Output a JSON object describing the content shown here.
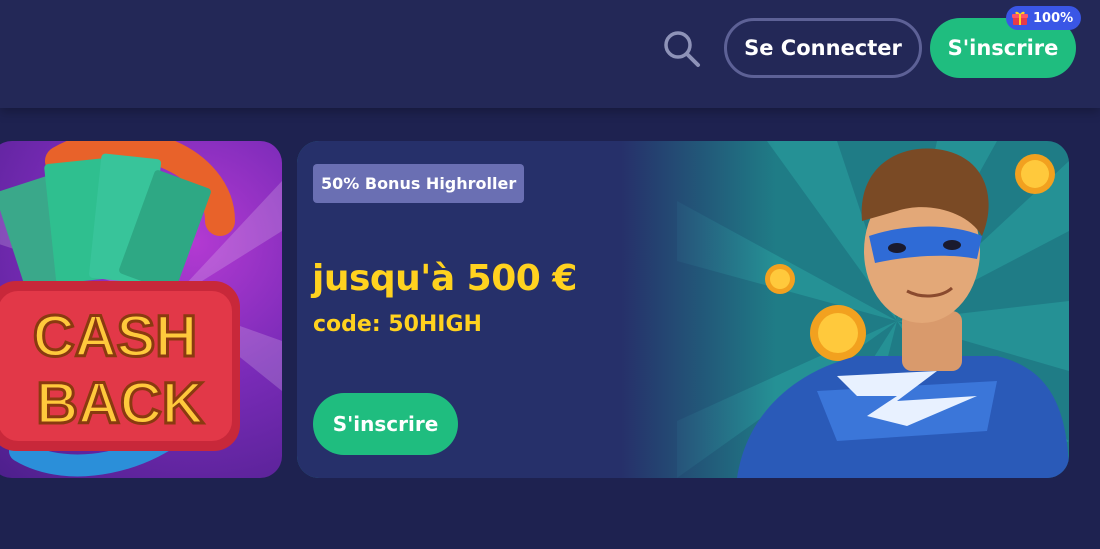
{
  "header": {
    "search_icon": "search-icon",
    "login_label": "Se Connecter",
    "signup_label": "S'inscrire",
    "badge": {
      "icon": "gift-icon",
      "text": "100%"
    }
  },
  "cards": {
    "cashback": {
      "text_line1": "CASH",
      "text_line2": "BACK"
    },
    "promo": {
      "tag": "50% Bonus Highroller",
      "amount": "jusqu'à 500 €",
      "code": "code: 50HIGH",
      "signup_label": "S'inscrire"
    }
  },
  "colors": {
    "background": "#1e2250",
    "header": "#232857",
    "accent_green": "#1fbd7f",
    "badge_blue": "#3a56e6",
    "promo_yellow": "#ffd21f"
  }
}
